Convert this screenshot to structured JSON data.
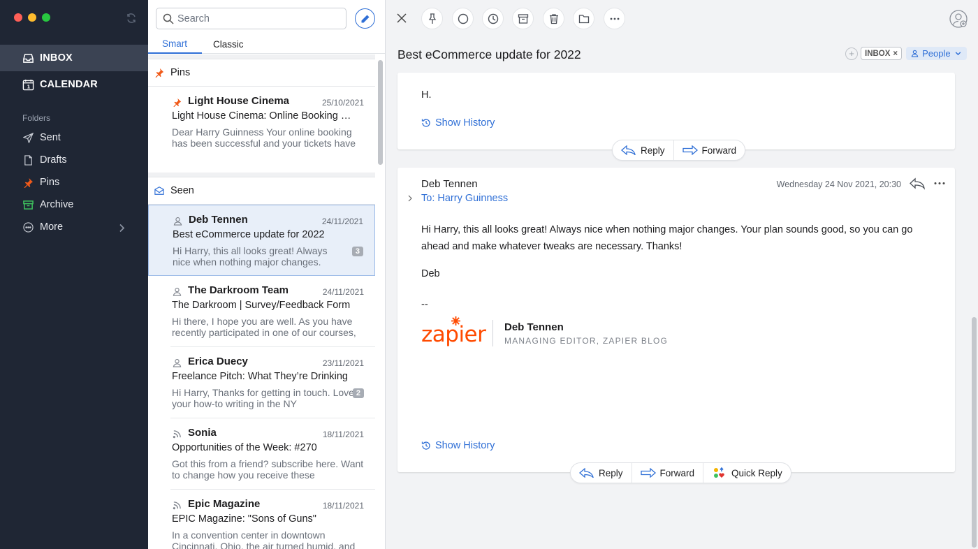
{
  "sidebar": {
    "main": [
      {
        "label": "INBOX",
        "icon": "inbox-icon",
        "active": true
      },
      {
        "label": "CALENDAR",
        "icon": "calendar-icon",
        "active": false
      }
    ],
    "folders_heading": "Folders",
    "folders": [
      {
        "label": "Sent",
        "icon": "send-icon"
      },
      {
        "label": "Drafts",
        "icon": "draft-icon"
      },
      {
        "label": "Pins",
        "icon": "pin-icon"
      },
      {
        "label": "Archive",
        "icon": "archive-icon"
      },
      {
        "label": "More",
        "icon": "more-circle-icon"
      }
    ],
    "calendar_day": "1"
  },
  "list": {
    "search_placeholder": "Search",
    "tabs": [
      "Smart",
      "Classic"
    ],
    "pins_heading": "Pins",
    "seen_heading": "Seen",
    "pinned": {
      "from": "Light House Cinema",
      "date": "25/10/2021",
      "subject": "Light House Cinema: Online Booking Confirmation",
      "preview": "Dear Harry Guinness Your online booking has been successful and your tickets have"
    },
    "messages": [
      {
        "from": "Deb Tennen",
        "date": "24/11/2021",
        "subject": "Best eCommerce update for 2022",
        "preview": "Hi Harry, this all looks great! Always nice when nothing major changes.",
        "count": "3",
        "icon": "person-icon"
      },
      {
        "from": "The Darkroom Team",
        "date": "24/11/2021",
        "subject": "The Darkroom | Survey/Feedback Form",
        "preview": "Hi there, I hope you are well. As you have recently participated in one of our courses,",
        "count": "",
        "icon": "person-icon"
      },
      {
        "from": "Erica Duecy",
        "date": "23/11/2021",
        "subject": "Freelance Pitch: What They’re Drinking",
        "preview": "Hi Harry, Thanks for getting in touch. Love your how-to writing in the NY",
        "count": "2",
        "icon": "person-icon"
      },
      {
        "from": "Sonia",
        "date": "18/11/2021",
        "subject": "Opportunities of the Week: #270",
        "preview": "Got this from a friend? subscribe here. Want to change how you receive these",
        "count": "",
        "icon": "rss-icon"
      },
      {
        "from": "Epic Magazine",
        "date": "18/11/2021",
        "subject": "EPIC Magazine: \"Sons of Guns\"",
        "preview": "In a convention center in downtown Cincinnati, Ohio, the air turned humid, and",
        "count": "",
        "icon": "rss-icon"
      }
    ]
  },
  "reader": {
    "subject": "Best eCommerce update for 2022",
    "tags": {
      "inbox": "INBOX",
      "people": "People"
    },
    "card1": {
      "greeting": "H.",
      "show_history": "Show History"
    },
    "actions": {
      "reply": "Reply",
      "forward": "Forward",
      "quick_reply": "Quick Reply"
    },
    "card2": {
      "sender": "Deb Tennen",
      "to": "To: Harry Guinness",
      "date": "Wednesday 24 Nov 2021, 20:30",
      "body": "Hi Harry, this all looks great! Always nice when nothing major changes. Your plan sounds good, so you can go ahead and make whatever tweaks are necessary. Thanks!",
      "signoff": "Deb",
      "dashes": "--",
      "logo_text": "zapier",
      "sig_name": "Deb Tennen",
      "sig_role": "MANAGING EDITOR, ZAPIER BLOG",
      "show_history": "Show History"
    }
  },
  "colors": {
    "accent": "#2f6fd6",
    "sidebar": "#1f2634",
    "pin": "#f05a1a",
    "zapier": "#ff4a00",
    "archive": "#3ec25e"
  }
}
